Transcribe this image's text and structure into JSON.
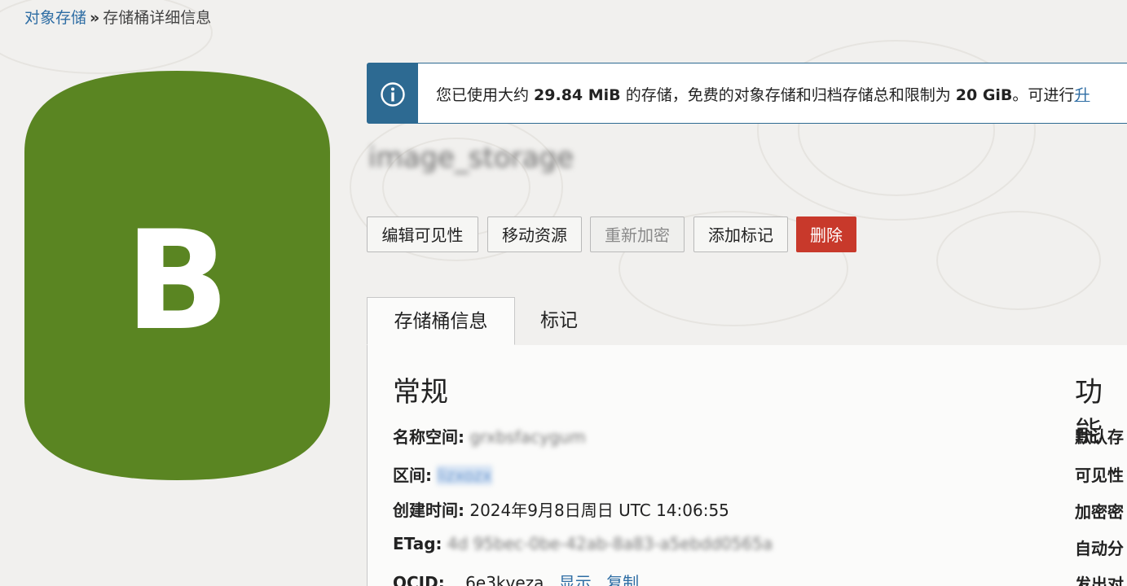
{
  "breadcrumb": {
    "root": "对象存储",
    "separator": "»",
    "current": "存储桶详细信息"
  },
  "logo": {
    "letter": "B",
    "color": "#5a8522"
  },
  "banner": {
    "icon": "info-icon",
    "prefix": "您已使用大约 ",
    "usage": "29.84 MiB",
    "middle": " 的存储，免费的对象存储和归档存储总和限制为 ",
    "limit": "20 GiB",
    "suffix": "。可进行",
    "link": "升"
  },
  "bucket": {
    "name": "image_storage"
  },
  "actions": {
    "edit_visibility": "编辑可见性",
    "move_resource": "移动资源",
    "re_encrypt": "重新加密",
    "add_tags": "添加标记",
    "delete": "删除"
  },
  "tabs": [
    {
      "label": "存储桶信息",
      "active": true
    },
    {
      "label": "标记",
      "active": false
    }
  ],
  "general": {
    "title": "常规",
    "namespace_label": "名称空间:",
    "namespace_value": "grxbsfacygum",
    "compartment_label": "区间:",
    "compartment_value": "lizxozx",
    "created_label": "创建时间:",
    "created_value": "2024年9月8日周日 UTC 14:06:55",
    "etag_label": "ETag:",
    "etag_value": "4d 95bec-0be-42ab-8a83-a5ebdd0565a",
    "ocid_label": "OCID:",
    "ocid_value": "...6e3kveza",
    "ocid_show": "显示",
    "ocid_copy": "复制"
  },
  "features": {
    "title": "功能",
    "default_storage": "默认存",
    "visibility": "可见性",
    "encryption": "加密密",
    "auto_tier": "自动分",
    "emit": "发出对"
  }
}
